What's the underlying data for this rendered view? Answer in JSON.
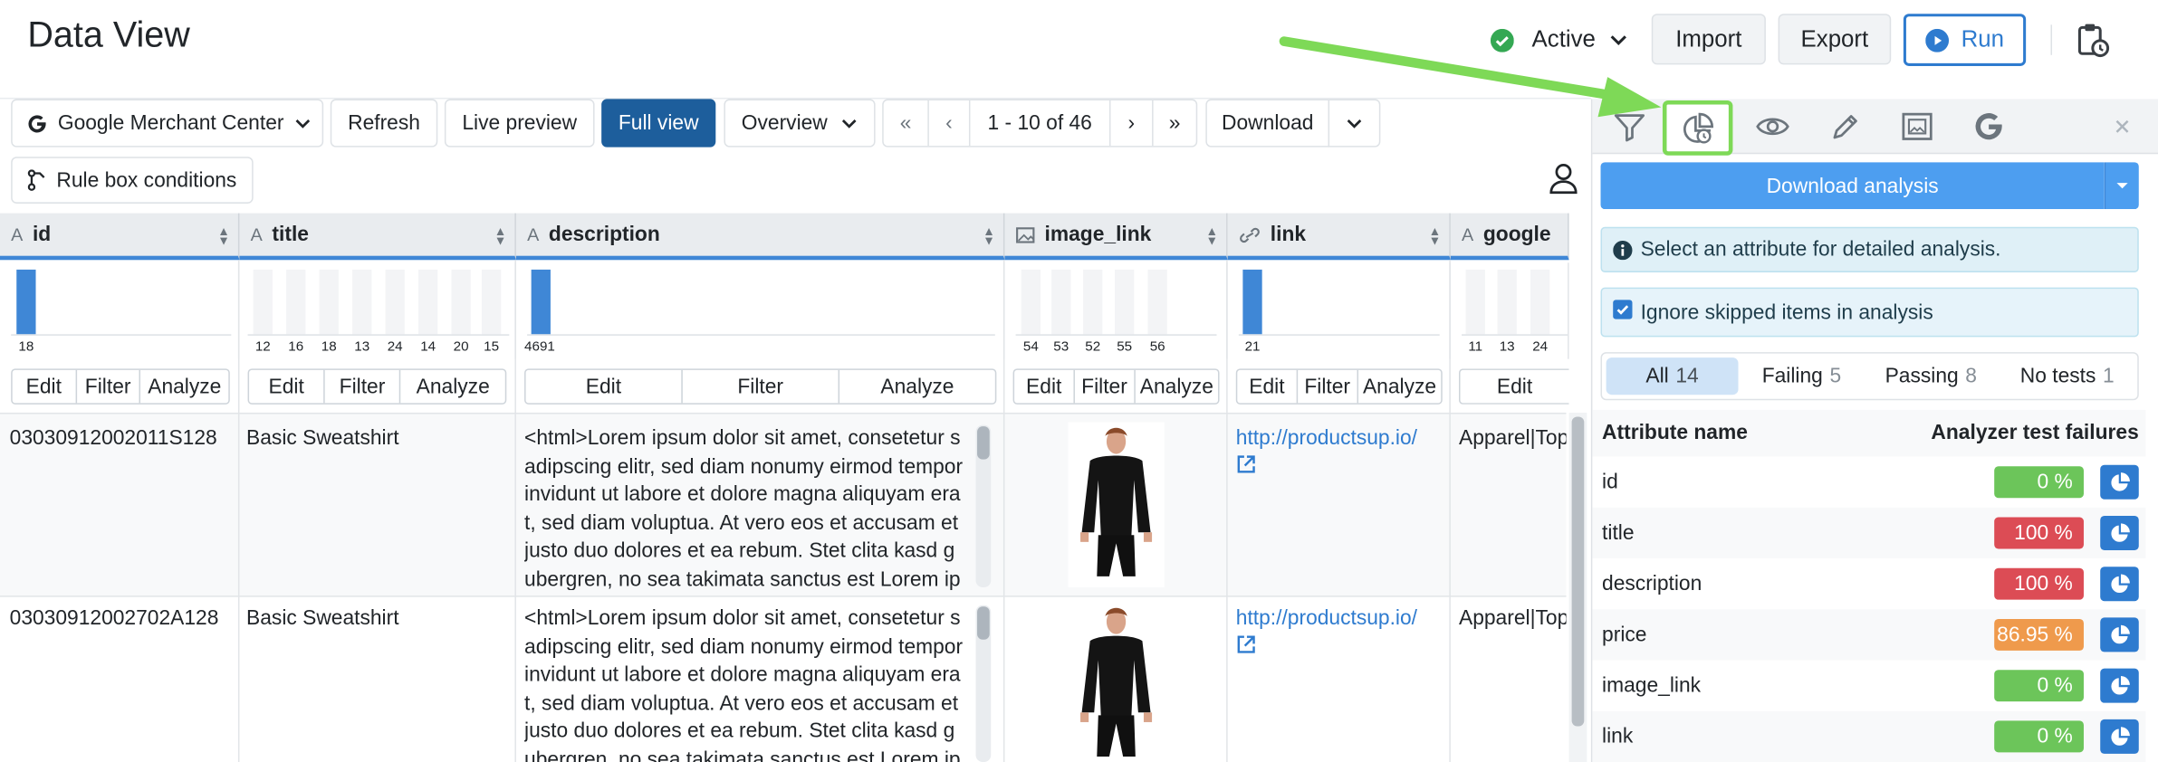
{
  "header": {
    "title": "Data View",
    "status": "Active",
    "import": "Import",
    "export": "Export",
    "run": "Run"
  },
  "toolbar": {
    "channel": "Google Merchant Center",
    "refresh": "Refresh",
    "live_preview": "Live preview",
    "full_view": "Full view",
    "overview": "Overview",
    "first": "«",
    "prev": "‹",
    "range": "1 - 10 of 46",
    "next": "›",
    "last": "»",
    "download": "Download",
    "rule_box": "Rule box conditions"
  },
  "columns": [
    {
      "name": "id",
      "bars": [
        "18"
      ]
    },
    {
      "name": "title",
      "bars": [
        "12",
        "16",
        "18",
        "13",
        "24",
        "14",
        "20",
        "15"
      ]
    },
    {
      "name": "description",
      "bars": [
        "4691"
      ]
    },
    {
      "name": "image_link",
      "bars": [
        "54",
        "53",
        "52",
        "55",
        "56"
      ]
    },
    {
      "name": "link",
      "bars": [
        "21"
      ]
    },
    {
      "name": "google",
      "bars": [
        "11",
        "13",
        "24"
      ]
    }
  ],
  "actions": {
    "edit": "Edit",
    "filter": "Filter",
    "analyze": "Analyze"
  },
  "rows": [
    {
      "id": "03030912002011S128",
      "title": "Basic Sweatshirt",
      "description": [
        "<html>Lorem ipsum dolor sit amet, consetetur s",
        "adipscing elitr, sed diam nonumy eirmod tempor",
        " invidunt ut labore et dolore magna aliquyam era",
        "t, sed diam voluptua. At vero eos et accusam et",
        "justo duo dolores et ea rebum. Stet clita kasd g",
        "ubergren, no sea takimata sanctus est Lorem ip"
      ],
      "link": "http://productsup.io/",
      "google": "Apparel|Top"
    },
    {
      "id": "03030912002702A128",
      "title": "Basic Sweatshirt",
      "description": [
        "<html>Lorem ipsum dolor sit amet, consetetur s",
        "adipscing elitr, sed diam nonumy eirmod tempor",
        " invidunt ut labore et dolore magna aliquyam era",
        "t, sed diam voluptua. At vero eos et accusam et",
        "justo duo dolores et ea rebum. Stet clita kasd g",
        "ubergren, no sea takimata sanctus est Lorem ip"
      ],
      "link": "http://productsup.io/",
      "google": "Apparel|Top"
    }
  ],
  "panel": {
    "download_analysis": "Download analysis",
    "info": "Select an attribute for detailed analysis.",
    "ignore": "Ignore skipped items in analysis",
    "tabs": [
      {
        "label": "All",
        "count": "14"
      },
      {
        "label": "Failing",
        "count": "5"
      },
      {
        "label": "Passing",
        "count": "8"
      },
      {
        "label": "No tests",
        "count": "1"
      }
    ],
    "col_attr": "Attribute name",
    "col_fail": "Analyzer test failures",
    "attributes": [
      {
        "name": "id",
        "value": "0 %",
        "color": "#6cc55a"
      },
      {
        "name": "title",
        "value": "100 %",
        "color": "#dc4c55"
      },
      {
        "name": "description",
        "value": "100 %",
        "color": "#dc4c55"
      },
      {
        "name": "price",
        "value": "86.95 %",
        "color": "#ef9a4c"
      },
      {
        "name": "image_link",
        "value": "0 %",
        "color": "#6cc55a"
      },
      {
        "name": "link",
        "value": "0 %",
        "color": "#6cc55a"
      }
    ]
  },
  "colors": {
    "primary": "#2e7bcf",
    "full_view_bg": "#1d5e9c",
    "highlight": "#7ed957",
    "arrow": "#7ed957"
  }
}
